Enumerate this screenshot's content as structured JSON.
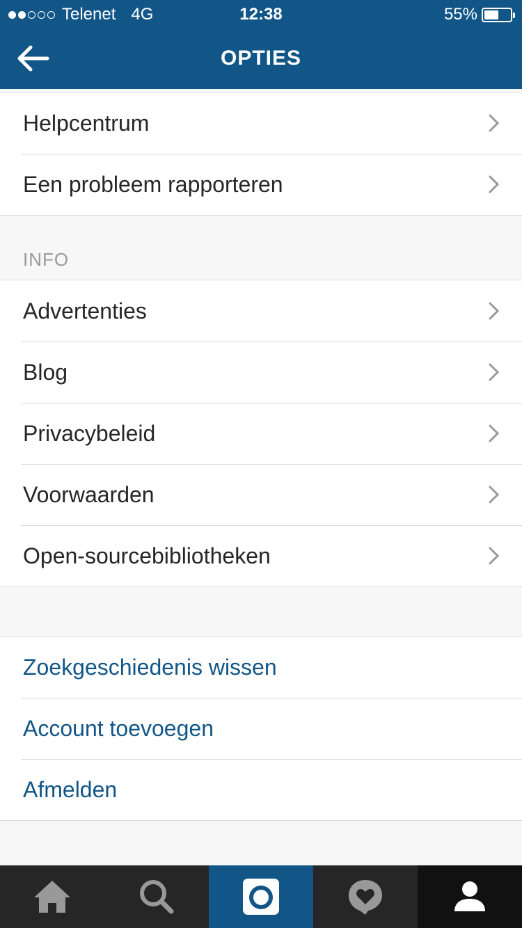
{
  "status": {
    "carrier": "Telenet",
    "network": "4G",
    "time": "12:38",
    "battery": "55%",
    "battery_level": 0.55,
    "signal_bars": 2,
    "signal_total": 5
  },
  "nav": {
    "title": "OPTIES",
    "back_icon": "arrow-left-icon"
  },
  "support": {
    "items": [
      "Helpcentrum",
      "Een probleem rapporteren"
    ]
  },
  "info": {
    "header": "INFO",
    "items": [
      "Advertenties",
      "Blog",
      "Privacybeleid",
      "Voorwaarden",
      "Open-sourcebibliotheken"
    ]
  },
  "actions": {
    "items": [
      "Zoekgeschiedenis wissen",
      "Account toevoegen",
      "Afmelden"
    ]
  },
  "tabs": [
    "home-icon",
    "search-icon",
    "camera-icon",
    "activity-heart-icon",
    "profile-icon"
  ],
  "colors": {
    "brand": "#125688",
    "tabbar": "#262626",
    "active_tab": "#111111",
    "tab_icon": "#999999",
    "separator": "#dbdbdb",
    "background": "#f7f7f7"
  }
}
